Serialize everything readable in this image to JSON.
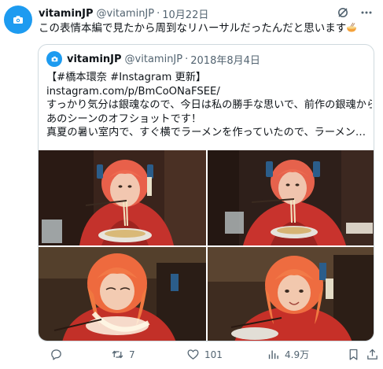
{
  "tweet": {
    "display_name": "vitaminJP",
    "handle": "@vitaminJP",
    "separator": "·",
    "date": "10月22日",
    "text": "この表情本編で見たから周到なリハーサルだったんだと思います",
    "emoji": "ramen-bowl"
  },
  "quoted": {
    "display_name": "vitaminJP",
    "handle": "@vitaminJP",
    "separator": "·",
    "date": "2018年8月4日",
    "lines": [
      "【#橋本環奈 #Instagram 更新】",
      "instagram.com/p/BmCoONaFSEE/",
      "すっかり気分は銀魂なので、今日は私の勝手な思いで、前作の銀魂から",
      "あのシーンのオフショットです！",
      "真夏の暑い室内で、すぐ横でラーメンを作っていたので、ラーメン屋の..."
    ],
    "photos": [
      "photo-1",
      "photo-2",
      "photo-3",
      "photo-4"
    ]
  },
  "actions": {
    "reply_count": "",
    "retweet_count": "7",
    "like_count": "101",
    "views_count": "4.9万"
  },
  "icons": [
    "camera-avatar-icon",
    "grok-icon",
    "more-icon",
    "reply-icon",
    "retweet-icon",
    "like-icon",
    "views-icon",
    "bookmark-icon",
    "share-icon"
  ],
  "colors": {
    "accent": "#1d9bf0",
    "text": "#0f1419",
    "muted": "#536471",
    "border": "#cfd9de"
  }
}
